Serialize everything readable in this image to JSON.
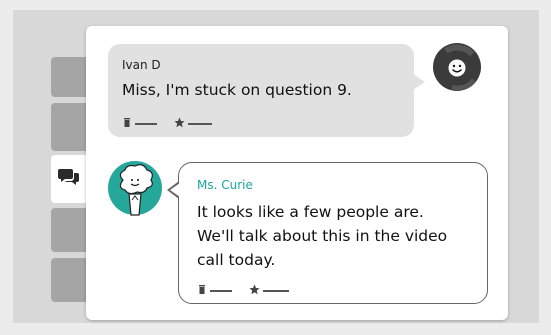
{
  "messages": [
    {
      "sender": "Ivan D",
      "text": "Miss, I'm stuck on question 9.",
      "avatar_icon": "smiley-face-avatar-icon",
      "actions": [
        "delete-icon",
        "star-icon"
      ]
    },
    {
      "sender": "Ms. Curie",
      "text_lines": [
        "It looks like a few people are.",
        "We'll talk about this in the video",
        "call today."
      ],
      "avatar_icon": "cartoon-person-avatar-icon",
      "actions": [
        "delete-icon",
        "star-icon"
      ]
    }
  ],
  "sidebar": {
    "active_tab_icon": "chat-bubbles-icon"
  },
  "colors": {
    "teacher_name": "#1aa89c",
    "teacher_avatar_bg": "#25a89b",
    "student_avatar_bg": "#3b3b3b",
    "student_bubble": "#e1e1e1"
  }
}
